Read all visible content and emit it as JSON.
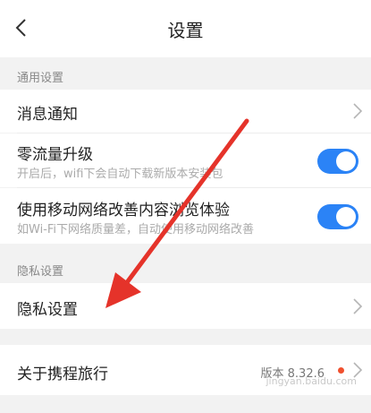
{
  "header": {
    "title": "设置"
  },
  "sections": {
    "general_title": "通用设置",
    "privacy_title": "隐私设置"
  },
  "rows": {
    "notifications": {
      "label": "消息通知"
    },
    "zero_traffic": {
      "label": "零流量升级",
      "sub": "开启后，wifi下会自动下载新版本安装包",
      "enabled": true
    },
    "mobile_network": {
      "label": "使用移动网络改善内容浏览体验",
      "sub": "如Wi-Fi下网络质量差，自动使用移动网络改善",
      "enabled": true
    },
    "privacy": {
      "label": "隐私设置"
    },
    "about": {
      "label": "关于携程旅行",
      "version": "版本 8.32.6"
    }
  },
  "watermark": "jingyan.baidu.com",
  "colors": {
    "toggle_on": "#2b83f6",
    "arrow": "#e5332a",
    "update_dot": "#f0502e"
  }
}
